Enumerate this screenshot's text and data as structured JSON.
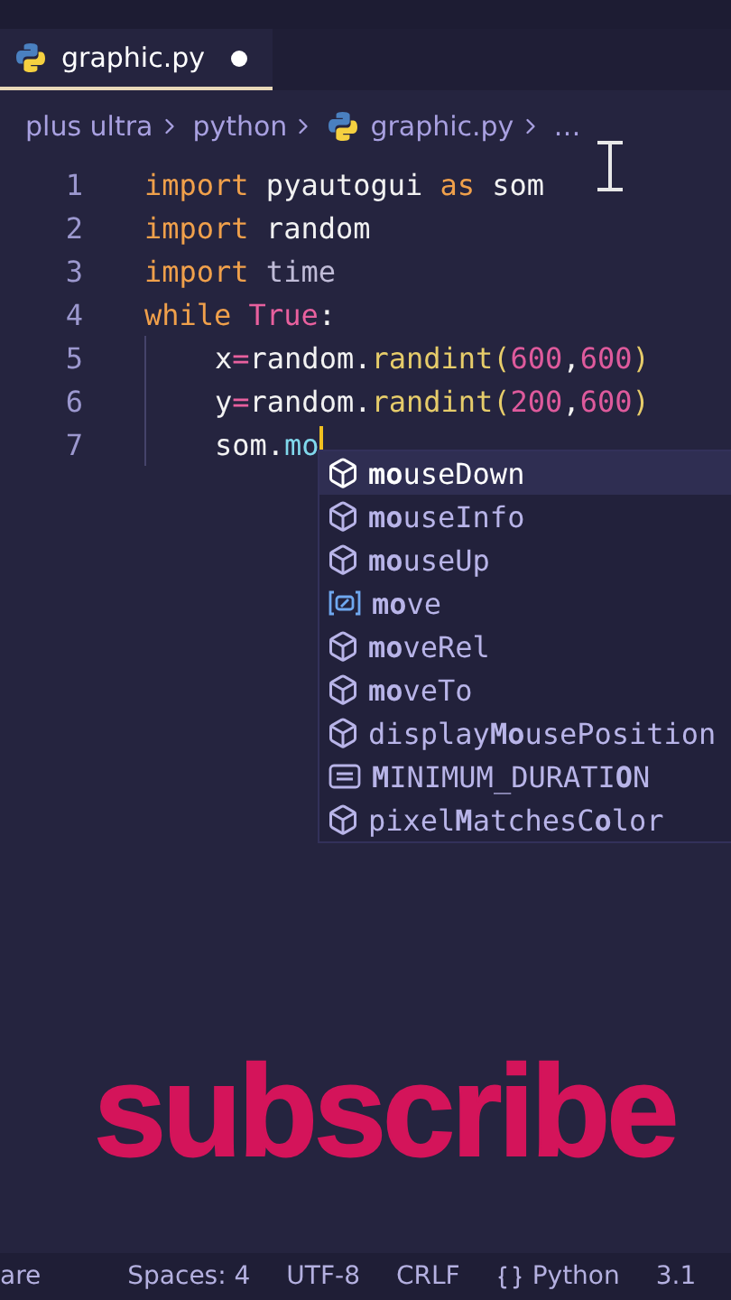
{
  "tab": {
    "title": "graphic.py",
    "modified": true
  },
  "breadcrumb": [
    {
      "kind": "folder",
      "text": "plus ultra"
    },
    {
      "kind": "folder",
      "text": "python"
    },
    {
      "kind": "file",
      "text": "graphic.py"
    },
    {
      "kind": "more",
      "text": "…"
    }
  ],
  "code_lines": [
    {
      "number": "1",
      "indented": false,
      "cursor": false,
      "tokens": [
        {
          "kind": "keyword",
          "text": "import"
        },
        {
          "kind": "plain",
          "text": " pyautogui "
        },
        {
          "kind": "keyword",
          "text": "as"
        },
        {
          "kind": "plain",
          "text": " som"
        }
      ]
    },
    {
      "number": "2",
      "indented": false,
      "cursor": false,
      "tokens": [
        {
          "kind": "keyword",
          "text": "import"
        },
        {
          "kind": "plain",
          "text": " random"
        }
      ]
    },
    {
      "number": "3",
      "indented": false,
      "cursor": false,
      "tokens": [
        {
          "kind": "keyword",
          "text": "import"
        },
        {
          "kind": "dim",
          "text": " time"
        }
      ]
    },
    {
      "number": "4",
      "indented": false,
      "cursor": false,
      "tokens": [
        {
          "kind": "keyword",
          "text": "while"
        },
        {
          "kind": "constant",
          "text": " True"
        },
        {
          "kind": "plain",
          "text": ":"
        }
      ]
    },
    {
      "number": "5",
      "indented": true,
      "cursor": false,
      "tokens": [
        {
          "kind": "plain",
          "text": "x"
        },
        {
          "kind": "operator",
          "text": "="
        },
        {
          "kind": "plain",
          "text": "random."
        },
        {
          "kind": "function",
          "text": "randint("
        },
        {
          "kind": "number",
          "text": "600"
        },
        {
          "kind": "plain",
          "text": ","
        },
        {
          "kind": "number",
          "text": "600"
        },
        {
          "kind": "function",
          "text": ")"
        }
      ]
    },
    {
      "number": "6",
      "indented": true,
      "cursor": false,
      "tokens": [
        {
          "kind": "plain",
          "text": "y"
        },
        {
          "kind": "operator",
          "text": "="
        },
        {
          "kind": "plain",
          "text": "random."
        },
        {
          "kind": "function",
          "text": "randint("
        },
        {
          "kind": "number",
          "text": "200"
        },
        {
          "kind": "plain",
          "text": ","
        },
        {
          "kind": "number",
          "text": "600"
        },
        {
          "kind": "function",
          "text": ")"
        }
      ]
    },
    {
      "number": "7",
      "indented": true,
      "cursor": true,
      "tokens": [
        {
          "kind": "plain",
          "text": "som."
        },
        {
          "kind": "member",
          "text": "mo"
        }
      ]
    }
  ],
  "suggestions": [
    {
      "kind": "method",
      "label": "**mo**useDown",
      "selected": true
    },
    {
      "kind": "method",
      "label": "**mo**useInfo",
      "selected": false
    },
    {
      "kind": "method",
      "label": "**mo**useUp",
      "selected": false
    },
    {
      "kind": "variable",
      "label": "**mo**ve",
      "selected": false
    },
    {
      "kind": "method",
      "label": "**mo**veRel",
      "selected": false
    },
    {
      "kind": "method",
      "label": "**mo**veTo",
      "selected": false
    },
    {
      "kind": "method",
      "label": "display**Mo**usePosition",
      "selected": false
    },
    {
      "kind": "constant",
      "label": "**M**INIMUM_DURATI**O**N",
      "selected": false
    },
    {
      "kind": "method",
      "label": "pixel**M**atchesC**o**lor",
      "selected": false
    }
  ],
  "overlay_text": "subscribe",
  "status_bar": [
    {
      "kind": "text",
      "text": "are"
    },
    {
      "kind": "text",
      "text": "Spaces: 4"
    },
    {
      "kind": "text",
      "text": "UTF-8"
    },
    {
      "kind": "text",
      "text": "CRLF"
    },
    {
      "kind": "language",
      "text": "Python"
    },
    {
      "kind": "text",
      "text": "3.1"
    }
  ]
}
